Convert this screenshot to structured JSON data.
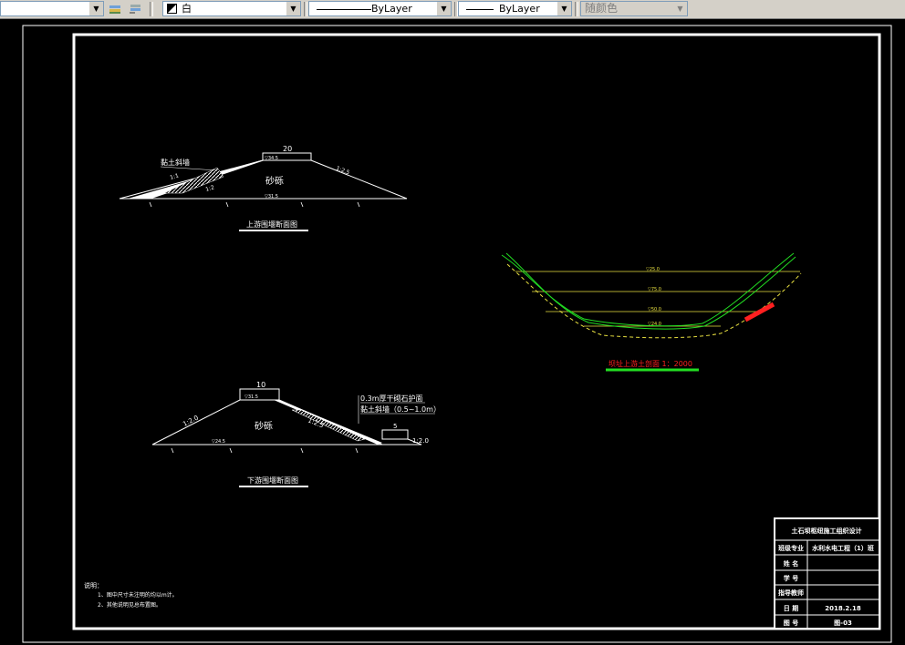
{
  "toolbar": {
    "color": "白",
    "linetype": "ByLayer",
    "lineweight": "ByLayer",
    "plotstyle": "随颜色"
  },
  "upstream": {
    "crest_width": "20",
    "crest_elev": "▽34.5",
    "base_elev": "▽31.5",
    "core_label": "黏土斜墙",
    "slope_left_1": "1:1",
    "slope_left_2": "1:2",
    "slope_right": "1:2.5",
    "material": "砂砾",
    "title": "上游围堰断面图"
  },
  "downstream": {
    "crest_width": "10",
    "crest_elev": "▽31.5",
    "base_elev": "▽24.5",
    "slope_left": "1:2.0",
    "slope_mid": "1:2.5",
    "slope_right": "1:2.0",
    "material": "砂砾",
    "note1": "0.3m厚干砌石护面",
    "note2": "黏土斜墙（0.5~1.0m）",
    "berm": "5",
    "title": "下游围堰断面图"
  },
  "river": {
    "elev1": "▽25.0",
    "elev2": "▽75.0",
    "elev3": "▽50.0",
    "elev4": "▽24.0",
    "title": "坝址上游土剖面  1：2000"
  },
  "notes": {
    "heading": "说明：",
    "line1": "1、图中尺寸未注明的均以m计。",
    "line2": "2、其他说明见总布置图。"
  },
  "title_block": {
    "title": "土石坝枢纽施工组织设计",
    "r1_label": "班级专业",
    "r1_value": "水利水电工程（1）班",
    "r2_label": "姓 名",
    "r2_value": "",
    "r3_label": "学 号",
    "r3_value": "",
    "r4_label": "指导教师",
    "r4_value": "",
    "r5_label": "日 期",
    "r5_value": "2018.2.18",
    "r6_label": "图 号",
    "r6_value": "图-03"
  }
}
